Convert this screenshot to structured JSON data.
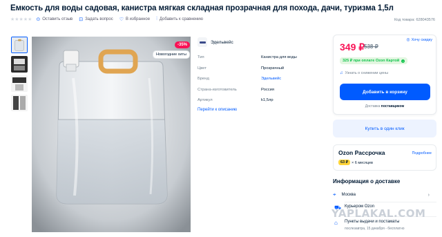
{
  "product": {
    "title": "Емкость для воды садовая, канистра мягкая складная прозрачная для похода, дачи, туризма 1,5л",
    "code": "Код товара: 628043576"
  },
  "actions": {
    "reviews": "Оставить отзыв",
    "question": "Задать вопрос",
    "favorites": "В избранное",
    "compare": "Добавить к сравнению"
  },
  "badges": {
    "discount": "-35%",
    "new_year": "Новогодние хиты"
  },
  "brand": {
    "name": "Эдельвейс"
  },
  "specs": [
    {
      "key": "Тип",
      "value": "Канистра для воды"
    },
    {
      "key": "Цвет",
      "value": "Прозрачный"
    },
    {
      "key": "Бренд",
      "value": "Эдельвейс"
    },
    {
      "key": "Страна-изготовитель",
      "value": "Россия"
    },
    {
      "key": "Артикул",
      "value": "k1,5лр"
    }
  ],
  "to_description": "Перейти к описанию",
  "price": {
    "current": "349 ₽",
    "old": "538 ₽",
    "watch": "Хочу скидку",
    "ozon_card": "325 ₽ при оплате Ozon Картой",
    "notify": "Узнать о снижении цены",
    "add_to_cart": "Добавить в корзину",
    "delivery_prefix": "Доставка",
    "delivery_brand": "поставщиком"
  },
  "one_click": "Купить в один клик",
  "installment": {
    "title": "Ozon Рассрочка",
    "more": "Подробнее",
    "amount": "63 ₽",
    "term": "× 6 месяцев"
  },
  "delivery": {
    "title": "Информация о доставке",
    "city": "Москва",
    "courier": "Курьером Ozon",
    "pickup": "Пункты выдачи и постаматы",
    "pickup_sub": "послезавтра, 15 декабря - бесплатно"
  },
  "watermark": "YAPLAKAL.COM",
  "colors": {
    "accent": "#005bff",
    "price": "#f91155",
    "card_green": "#10c44c",
    "installment_yellow": "#ffd438"
  }
}
